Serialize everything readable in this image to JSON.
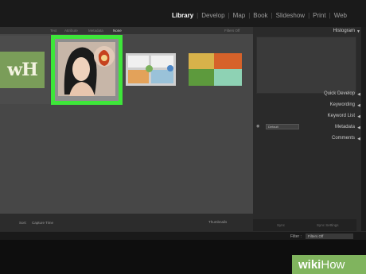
{
  "modules": [
    "Library",
    "Develop",
    "Map",
    "Book",
    "Slideshow",
    "Print",
    "Web"
  ],
  "active_module": "Library",
  "filterbar": {
    "labels": [
      "Text",
      "Attribute",
      "Metadata",
      "None"
    ],
    "active": "None",
    "right_label": "Filters Off"
  },
  "grid": {
    "thumb1_text": "wH",
    "sort_label": "Sort:",
    "sort_value": "Capture Time",
    "thumbnails_label": "Thumbnails"
  },
  "right_panel": {
    "histogram": "Histogram",
    "quick_develop": "Quick Develop",
    "keywording": "Keywording",
    "keyword_list": "Keyword List",
    "metadata": "Metadata",
    "metadata_preset": "Default",
    "comments": "Comments",
    "sync": "Sync",
    "sync_settings": "Sync Settings"
  },
  "filmstrip": {
    "filter_label": "Filter :",
    "filter_value": "Filters Off"
  },
  "watermark": {
    "part1": "wiki",
    "part2": "How"
  },
  "colors": {
    "selection": "#3ee63a",
    "watermark": "#80b45e"
  }
}
